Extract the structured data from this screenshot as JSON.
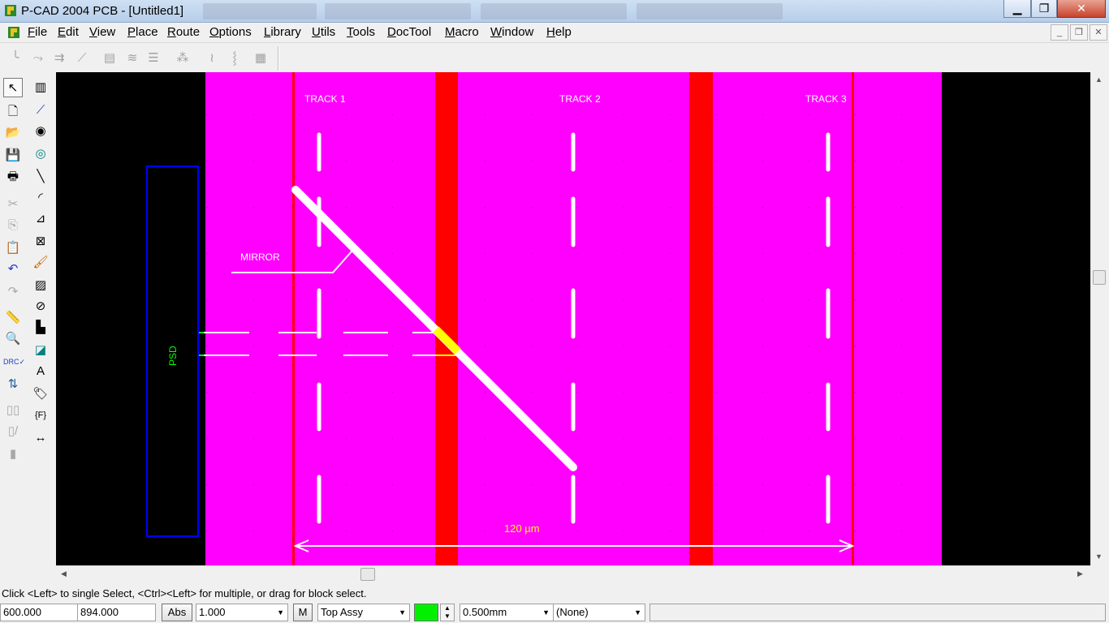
{
  "window": {
    "title": "P-CAD 2004 PCB - [Untitled1]",
    "buttons": {
      "minimize": "▁",
      "restore": "❐",
      "close": "✕"
    }
  },
  "menu": [
    "File",
    "Edit",
    "View",
    "Place",
    "Route",
    "Options",
    "Library",
    "Utils",
    "Tools",
    "DocTool",
    "Macro",
    "Window",
    "Help"
  ],
  "mdi_buttons": {
    "minimize": "_",
    "restore": "❐",
    "close": "✕"
  },
  "canvas": {
    "track_labels": [
      "TRACK 1",
      "TRACK 2",
      "TRACK 3"
    ],
    "mirror_label": "MIRROR",
    "psd_label": "PSD",
    "dimension_label": "120 µm",
    "colors": {
      "background": "#000000",
      "board": "#ff00ff",
      "track_edge": "#ff0000",
      "psd_outline": "#0000ff",
      "beam": "#ffffff",
      "highlight": "#ffff00",
      "dimension": "#ffff00"
    }
  },
  "status": {
    "message": "Click <Left> to single Select, <Ctrl><Left> for multiple, or drag for block select.",
    "x_coord": "600.000",
    "y_coord": "894.000",
    "abs_button": "Abs",
    "zoom": "1.000",
    "m_button": "M",
    "layer": "Top Assy",
    "layer_color": "#00f000",
    "line_width": "0.500mm",
    "net": "(None)"
  }
}
